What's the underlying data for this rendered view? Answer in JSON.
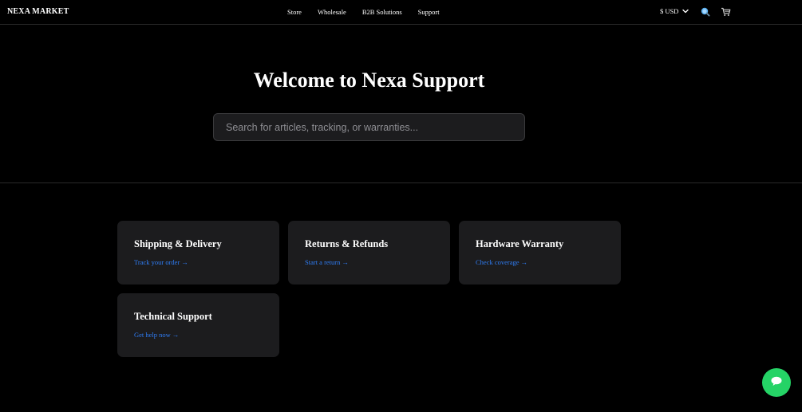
{
  "header": {
    "brand": "NEXA MARKET",
    "nav": [
      {
        "label": "Store"
      },
      {
        "label": "Wholesale"
      },
      {
        "label": "B2B Solutions"
      },
      {
        "label": "Support"
      }
    ],
    "currency": "$ USD",
    "icons": {
      "search": "search-icon",
      "cart": "cart-icon",
      "currency_dropdown": "chevron-down-icon"
    }
  },
  "hero": {
    "title": "Welcome to Nexa Support",
    "search_placeholder": "Search for articles, tracking, or warranties..."
  },
  "cards": [
    {
      "title": "Shipping & Delivery",
      "link": "Track your order →"
    },
    {
      "title": "Returns & Refunds",
      "link": "Start a return →"
    },
    {
      "title": "Hardware Warranty",
      "link": "Check coverage →"
    },
    {
      "title": "Technical Support",
      "link": "Get help now →"
    }
  ],
  "chat": {
    "icon": "chat-bubble-icon",
    "color": "#25d366"
  },
  "colors": {
    "background": "#000000",
    "card": "#1c1c1e",
    "link": "#2f7df6"
  }
}
